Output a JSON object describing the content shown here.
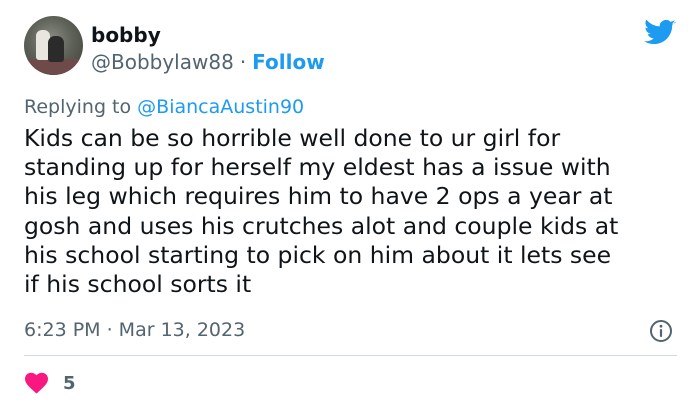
{
  "tweet": {
    "author": {
      "display_name": "bobby",
      "handle": "@Bobbylaw88",
      "separator": "·",
      "follow_label": "Follow"
    },
    "reply": {
      "prefix": "Replying to",
      "mention": "@BiancaAustin90"
    },
    "text": "Kids can be so horrible well done to ur girl for\nstanding up for herself my eldest has a issue with\nhis leg which requires him to have 2 ops a year at\ngosh and uses his crutches alot and couple kids at\nhis school starting to pick on him about it lets see\nif his school sorts it",
    "timestamp": "6:23 PM · Mar 13, 2023",
    "likes": "5"
  },
  "colors": {
    "brand_blue": "#1d9bf0",
    "like_red": "#f91880",
    "secondary_text": "#536471",
    "divider": "#cfd9de"
  },
  "icons": {
    "brand": "twitter-bird-icon",
    "info": "info-icon",
    "like": "heart-icon"
  }
}
